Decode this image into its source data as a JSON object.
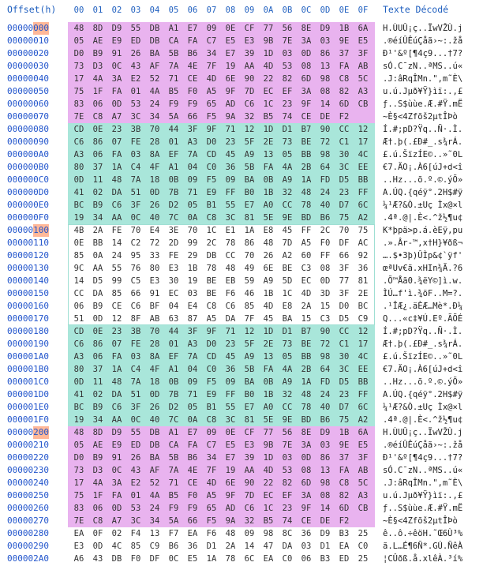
{
  "header": {
    "offset": "Offset(h)",
    "columns": [
      "00",
      "01",
      "02",
      "03",
      "04",
      "05",
      "06",
      "07",
      "08",
      "09",
      "0A",
      "0B",
      "0C",
      "0D",
      "0E",
      "0F"
    ],
    "text": "Texte Décodé"
  },
  "colors": {
    "pink": "#e9b3ef",
    "teal": "#a9e6da",
    "offset_highlight": "#ffb899",
    "header_blue": "#1f5fbf"
  },
  "rows": [
    {
      "offset": "00000000",
      "hl": "000",
      "hex": [
        "48",
        "8D",
        "D9",
        "55",
        "DB",
        "A1",
        "E7",
        "09",
        "0E",
        "CF",
        "77",
        "56",
        "8E",
        "D9",
        "1B",
        "6A"
      ],
      "text": "H.ÙUÛ¡ç..ÏwVŽÙ.j"
    },
    {
      "offset": "00000010",
      "hex": [
        "05",
        "AE",
        "E9",
        "ED",
        "DB",
        "CA",
        "FA",
        "C7",
        "E5",
        "E3",
        "9B",
        "7E",
        "3A",
        "03",
        "9E",
        "E5"
      ],
      "text": ".®éíÛÊúÇåã›~:.žå"
    },
    {
      "offset": "00000020",
      "hex": [
        "D0",
        "B9",
        "91",
        "26",
        "BA",
        "5B",
        "B6",
        "34",
        "E7",
        "39",
        "1D",
        "03",
        "0D",
        "86",
        "37",
        "3F"
      ],
      "text": "Ð¹'&º[¶4ç9...†7?"
    },
    {
      "offset": "00000030",
      "hex": [
        "73",
        "D3",
        "0C",
        "43",
        "AF",
        "7A",
        "4E",
        "7F",
        "19",
        "AA",
        "4D",
        "53",
        "08",
        "13",
        "FA",
        "AB"
      ],
      "text": "sÓ.C¯zN..ªMS..ú«"
    },
    {
      "offset": "00000040",
      "hex": [
        "17",
        "4A",
        "3A",
        "E2",
        "52",
        "71",
        "CE",
        "4D",
        "6E",
        "90",
        "22",
        "82",
        "6D",
        "98",
        "C8",
        "5C"
      ],
      "text": ".J:âRqÎMn.\",m˜È\\"
    },
    {
      "offset": "00000050",
      "hex": [
        "75",
        "1F",
        "FA",
        "01",
        "4A",
        "B5",
        "F0",
        "A5",
        "9F",
        "7D",
        "EC",
        "EF",
        "3A",
        "08",
        "82",
        "A3"
      ],
      "text": "u.ú.Jµð¥Ÿ}ìï:.‚£"
    },
    {
      "offset": "00000060",
      "hex": [
        "83",
        "06",
        "0D",
        "53",
        "24",
        "F9",
        "F9",
        "65",
        "AD",
        "C6",
        "1C",
        "23",
        "9F",
        "14",
        "6D",
        "CB"
      ],
      "text": "ƒ..S$ùùe.Æ.#Ÿ.mË"
    },
    {
      "offset": "00000070",
      "hex": [
        "7E",
        "C8",
        "A7",
        "3C",
        "34",
        "5A",
        "66",
        "F5",
        "9A",
        "32",
        "B5",
        "74",
        "CE",
        "DE",
        "F2"
      ],
      "text": "~È§<4Zfõš2µtÎÞò"
    },
    {
      "offset": "00000080",
      "hex": [
        "CD",
        "0E",
        "23",
        "3B",
        "70",
        "44",
        "3F",
        "9F",
        "71",
        "12",
        "1D",
        "D1",
        "B7",
        "90",
        "CC",
        "12"
      ],
      "text": "Í.#;pD?Ÿq..Ñ·.Ì."
    },
    {
      "offset": "00000090",
      "hex": [
        "C6",
        "86",
        "07",
        "FE",
        "28",
        "01",
        "A3",
        "D0",
        "23",
        "5F",
        "2E",
        "73",
        "BE",
        "72",
        "C1",
        "17"
      ],
      "text": "Æ†.þ(.£Ð#_.s¾rÁ."
    },
    {
      "offset": "000000A0",
      "hex": [
        "A3",
        "06",
        "FA",
        "03",
        "8A",
        "EF",
        "7A",
        "CD",
        "45",
        "A9",
        "13",
        "05",
        "BB",
        "98",
        "30",
        "4C"
      ],
      "text": "£.ú.ŠïzÍE©..»˜0L"
    },
    {
      "offset": "000000B0",
      "hex": [
        "80",
        "37",
        "1A",
        "C4",
        "4F",
        "A1",
        "04",
        "C0",
        "36",
        "5B",
        "FA",
        "4A",
        "2B",
        "64",
        "3C",
        "EE"
      ],
      "text": "€7.ÄO¡.À6[úJ+d<î"
    },
    {
      "offset": "000000C0",
      "hex": [
        "0D",
        "11",
        "48",
        "7A",
        "18",
        "0B",
        "09",
        "F5",
        "09",
        "BA",
        "0B",
        "A9",
        "1A",
        "FD",
        "D5",
        "BB"
      ],
      "text": "..Hz...õ.º.©.ýÕ»"
    },
    {
      "offset": "000000D0",
      "hex": [
        "41",
        "02",
        "DA",
        "51",
        "0D",
        "7B",
        "71",
        "E9",
        "FF",
        "B0",
        "1B",
        "32",
        "48",
        "24",
        "23",
        "FF"
      ],
      "text": "A.ÚQ.{qéÿ°.2H$#ÿ"
    },
    {
      "offset": "000000E0",
      "hex": [
        "BC",
        "B9",
        "C6",
        "3F",
        "26",
        "D2",
        "05",
        "B1",
        "55",
        "E7",
        "A0",
        "CC",
        "78",
        "40",
        "D7",
        "6C"
      ],
      "text": "¼¹Æ?&Ò.±Uç Ìx@×l"
    },
    {
      "offset": "000000F0",
      "hex": [
        "19",
        "34",
        "AA",
        "0C",
        "40",
        "7C",
        "0A",
        "C8",
        "3C",
        "81",
        "5E",
        "9E",
        "BD",
        "B6",
        "75",
        "A2"
      ],
      "text": ".4ª.@|.È<.^ž½¶u¢"
    },
    {
      "offset": "00000100",
      "hl": "100",
      "hex": [
        "4B",
        "2A",
        "FE",
        "70",
        "E4",
        "3E",
        "70",
        "1C",
        "E1",
        "1A",
        "E8",
        "45",
        "FF",
        "2C",
        "70",
        "75"
      ],
      "text": "K*þpä>p.á.èEÿ,pu"
    },
    {
      "offset": "00000110",
      "hex": [
        "0E",
        "BB",
        "14",
        "C2",
        "72",
        "2D",
        "99",
        "2C",
        "78",
        "86",
        "48",
        "7D",
        "A5",
        "F0",
        "DF",
        "AC"
      ],
      "text": ".».Âr-™,x†H}¥ðß¬"
    },
    {
      "offset": "00000120",
      "hex": [
        "85",
        "0A",
        "24",
        "95",
        "33",
        "FE",
        "29",
        "DB",
        "CC",
        "70",
        "26",
        "A2",
        "60",
        "FF",
        "66",
        "92"
      ],
      "text": "….$•3þ)ÛÌp&¢`ÿf'"
    },
    {
      "offset": "00000130",
      "hex": [
        "9C",
        "AA",
        "55",
        "76",
        "80",
        "E3",
        "1B",
        "78",
        "48",
        "49",
        "6E",
        "BE",
        "C3",
        "08",
        "3F",
        "36"
      ],
      "text": "œªUv€ã.xHIn¾Ã.?6"
    },
    {
      "offset": "00000140",
      "hex": [
        "14",
        "D5",
        "99",
        "C5",
        "E3",
        "30",
        "19",
        "BE",
        "EB",
        "59",
        "A9",
        "5D",
        "EC",
        "0D",
        "77",
        "81"
      ],
      "text": ".Õ™Åã0.¾ëY©]ì.w."
    },
    {
      "offset": "00000150",
      "hex": [
        "CC",
        "DA",
        "85",
        "66",
        "91",
        "EC",
        "03",
        "BE",
        "F6",
        "46",
        "1B",
        "1C",
        "4D",
        "3D",
        "3F",
        "2E"
      ],
      "text": "ÌÚ…f'ì.¾öF..M=?."
    },
    {
      "offset": "00000160",
      "hex": [
        "06",
        "B9",
        "CE",
        "C6",
        "BF",
        "04",
        "E4",
        "C8",
        "C6",
        "85",
        "4D",
        "E8",
        "2A",
        "15",
        "D0",
        "BC"
      ],
      "text": ".¹ÎÆ¿.äÈÆ…Mè*.Ð¼"
    },
    {
      "offset": "00000170",
      "hex": [
        "51",
        "0D",
        "12",
        "8F",
        "AB",
        "63",
        "87",
        "A5",
        "DA",
        "7F",
        "45",
        "BA",
        "15",
        "C3",
        "D5",
        "C9"
      ],
      "text": "Q...«c‡¥Ú.Eº.ÃÕÉ"
    },
    {
      "offset": "00000180",
      "hex": [
        "CD",
        "0E",
        "23",
        "3B",
        "70",
        "44",
        "3F",
        "9F",
        "71",
        "12",
        "1D",
        "D1",
        "B7",
        "90",
        "CC",
        "12"
      ],
      "text": "Í.#;pD?Ÿq..Ñ·.Ì."
    },
    {
      "offset": "00000190",
      "hex": [
        "C6",
        "86",
        "07",
        "FE",
        "28",
        "01",
        "A3",
        "D0",
        "23",
        "5F",
        "2E",
        "73",
        "BE",
        "72",
        "C1",
        "17"
      ],
      "text": "Æ†.þ(.£Ð#_.s¾rÁ."
    },
    {
      "offset": "000001A0",
      "hex": [
        "A3",
        "06",
        "FA",
        "03",
        "8A",
        "EF",
        "7A",
        "CD",
        "45",
        "A9",
        "13",
        "05",
        "BB",
        "98",
        "30",
        "4C"
      ],
      "text": "£.ú.ŠïzÍE©..»˜0L"
    },
    {
      "offset": "000001B0",
      "hex": [
        "80",
        "37",
        "1A",
        "C4",
        "4F",
        "A1",
        "04",
        "C0",
        "36",
        "5B",
        "FA",
        "4A",
        "2B",
        "64",
        "3C",
        "EE"
      ],
      "text": "€7.ÄO¡.À6[úJ+d<î"
    },
    {
      "offset": "000001C0",
      "hex": [
        "0D",
        "11",
        "48",
        "7A",
        "18",
        "0B",
        "09",
        "F5",
        "09",
        "BA",
        "0B",
        "A9",
        "1A",
        "FD",
        "D5",
        "BB"
      ],
      "text": "..Hz...õ.º.©.ýÕ»"
    },
    {
      "offset": "000001D0",
      "hex": [
        "41",
        "02",
        "DA",
        "51",
        "0D",
        "7B",
        "71",
        "E9",
        "FF",
        "B0",
        "1B",
        "32",
        "48",
        "24",
        "23",
        "FF"
      ],
      "text": "A.ÚQ.{qéÿ°.2H$#ÿ"
    },
    {
      "offset": "000001E0",
      "hex": [
        "BC",
        "B9",
        "C6",
        "3F",
        "26",
        "D2",
        "05",
        "B1",
        "55",
        "E7",
        "A0",
        "CC",
        "78",
        "40",
        "D7",
        "6C"
      ],
      "text": "¼¹Æ?&Ò.±Uç Ìx@×l"
    },
    {
      "offset": "000001F0",
      "hex": [
        "19",
        "34",
        "AA",
        "0C",
        "40",
        "7C",
        "0A",
        "C8",
        "3C",
        "81",
        "5E",
        "9E",
        "BD",
        "B6",
        "75",
        "A2"
      ],
      "text": ".4ª.@|.È<.^ž½¶u¢"
    },
    {
      "offset": "00000200",
      "hl": "200",
      "hex": [
        "48",
        "8D",
        "D9",
        "55",
        "DB",
        "A1",
        "E7",
        "09",
        "0E",
        "CF",
        "77",
        "56",
        "8E",
        "D9",
        "1B",
        "6A"
      ],
      "text": "H.ÙUÛ¡ç..ÏwVŽÙ.j"
    },
    {
      "offset": "00000210",
      "hex": [
        "05",
        "AE",
        "E9",
        "ED",
        "DB",
        "CA",
        "FA",
        "C7",
        "E5",
        "E3",
        "9B",
        "7E",
        "3A",
        "03",
        "9E",
        "E5"
      ],
      "text": ".®éíÛÊúÇåã›~:.žå"
    },
    {
      "offset": "00000220",
      "hex": [
        "D0",
        "B9",
        "91",
        "26",
        "BA",
        "5B",
        "B6",
        "34",
        "E7",
        "39",
        "1D",
        "03",
        "0D",
        "86",
        "37",
        "3F"
      ],
      "text": "Ð¹'&º[¶4ç9...†7?"
    },
    {
      "offset": "00000230",
      "hex": [
        "73",
        "D3",
        "0C",
        "43",
        "AF",
        "7A",
        "4E",
        "7F",
        "19",
        "AA",
        "4D",
        "53",
        "08",
        "13",
        "FA",
        "AB"
      ],
      "text": "sÓ.C¯zN..ªMS..ú«"
    },
    {
      "offset": "00000240",
      "hex": [
        "17",
        "4A",
        "3A",
        "E2",
        "52",
        "71",
        "CE",
        "4D",
        "6E",
        "90",
        "22",
        "82",
        "6D",
        "98",
        "C8",
        "5C"
      ],
      "text": ".J:âRqÎMn.\",m˜È\\"
    },
    {
      "offset": "00000250",
      "hex": [
        "75",
        "1F",
        "FA",
        "01",
        "4A",
        "B5",
        "F0",
        "A5",
        "9F",
        "7D",
        "EC",
        "EF",
        "3A",
        "08",
        "82",
        "A3"
      ],
      "text": "u.ú.Jµð¥Ÿ}ìï:.‚£"
    },
    {
      "offset": "00000260",
      "hex": [
        "83",
        "06",
        "0D",
        "53",
        "24",
        "F9",
        "F9",
        "65",
        "AD",
        "C6",
        "1C",
        "23",
        "9F",
        "14",
        "6D",
        "CB"
      ],
      "text": "ƒ..S$ùùe.Æ.#Ÿ.mË"
    },
    {
      "offset": "00000270",
      "hex": [
        "7E",
        "C8",
        "A7",
        "3C",
        "34",
        "5A",
        "66",
        "F5",
        "9A",
        "32",
        "B5",
        "74",
        "CE",
        "DE",
        "F2"
      ],
      "text": "~È§<4Zfõš2µtÎÞò"
    },
    {
      "offset": "00000280",
      "hex": [
        "EA",
        "0F",
        "02",
        "F4",
        "13",
        "F7",
        "EA",
        "F6",
        "48",
        "09",
        "98",
        "8C",
        "36",
        "D9",
        "B3",
        "25"
      ],
      "text": "ê..ô.÷êöH.˜Œ6Ù³%"
    },
    {
      "offset": "00000290",
      "hex": [
        "E3",
        "0D",
        "4C",
        "85",
        "C9",
        "B6",
        "36",
        "D1",
        "2A",
        "14",
        "47",
        "DA",
        "03",
        "D1",
        "EA",
        "C0"
      ],
      "text": "ã.L…É¶6Ñ*.GÚ.ÑêÀ"
    },
    {
      "offset": "000002A0",
      "hex": [
        "A6",
        "43",
        "DB",
        "F0",
        "DF",
        "0C",
        "E5",
        "1A",
        "78",
        "6C",
        "EA",
        "C0",
        "06",
        "B3",
        "ED",
        "25"
      ],
      "text": "¦CÛðß.å.xlêÀ.³í%"
    }
  ]
}
